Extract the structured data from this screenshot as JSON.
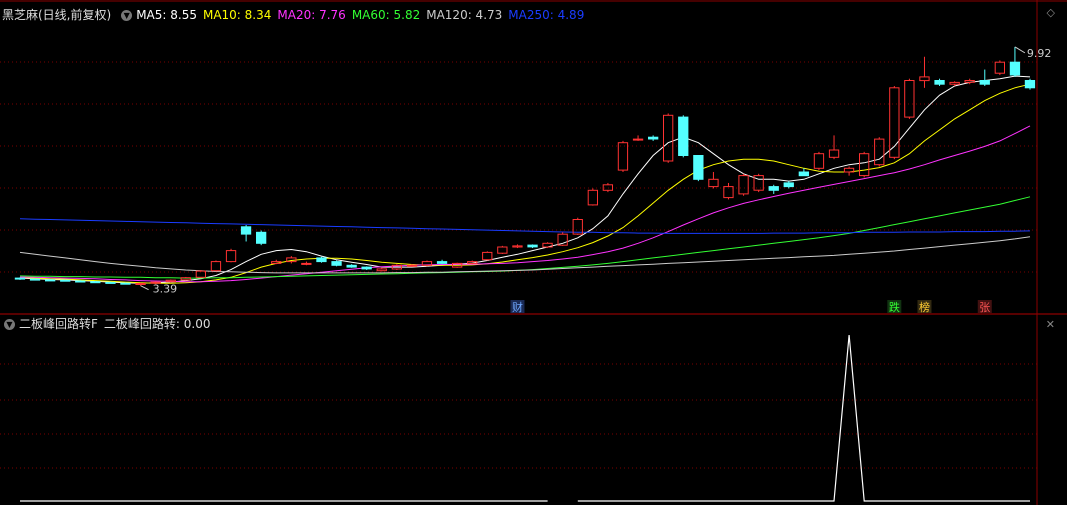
{
  "upper_header": {
    "stock_name": "黑芝麻(日线,前复权)",
    "ma": [
      {
        "label": "MA5: 8.55",
        "color": "#ffffff"
      },
      {
        "label": "MA10: 8.34",
        "color": "#ffff00"
      },
      {
        "label": "MA20: 7.76",
        "color": "#ff33ff"
      },
      {
        "label": "MA60: 5.82",
        "color": "#33ff33"
      },
      {
        "label": "MA120: 4.73",
        "color": "#cccccc"
      },
      {
        "label": "MA250: 4.89",
        "color": "#1a3cff"
      }
    ]
  },
  "lower_header": {
    "indicator_name": "二板峰回路转F",
    "indicator_value": "二板峰回路转: 0.00"
  },
  "chart_data": [
    {
      "type": "candlestick",
      "title": "黑芝麻(日线,前复权)",
      "high_label": "9.92",
      "low_label": "3.39",
      "ylim": [
        3.0,
        10.6
      ],
      "x": [
        1,
        2,
        3,
        4,
        5,
        6,
        7,
        8,
        9,
        10,
        11,
        12,
        13,
        14,
        15,
        16,
        17,
        18,
        19,
        20,
        21,
        22,
        23,
        24,
        25,
        26,
        27,
        28,
        29,
        30,
        31,
        32,
        33,
        34,
        35,
        36,
        37,
        38,
        39,
        40,
        41,
        42,
        43,
        44,
        45,
        46,
        47,
        48,
        49,
        50,
        51,
        52,
        53,
        54,
        55,
        56,
        57,
        58,
        59,
        60,
        61,
        62,
        63,
        64,
        65,
        66,
        67,
        68
      ],
      "open": [
        3.6,
        3.57,
        3.55,
        3.54,
        3.52,
        3.5,
        3.48,
        3.46,
        3.44,
        3.46,
        3.5,
        3.55,
        3.62,
        3.8,
        4.05,
        5.0,
        4.85,
        4.0,
        4.05,
        4.0,
        4.15,
        4.05,
        3.95,
        3.9,
        3.8,
        3.85,
        3.95,
        3.95,
        4.05,
        3.9,
        4.0,
        4.1,
        4.28,
        4.45,
        4.5,
        4.45,
        4.5,
        4.8,
        5.6,
        6.0,
        6.55,
        7.4,
        7.45,
        6.8,
        8.0,
        6.95,
        6.1,
        5.8,
        5.9,
        6.0,
        6.1,
        6.2,
        6.5,
        6.6,
        6.9,
        6.5,
        6.4,
        6.7,
        6.9,
        8.0,
        9.0,
        9.0,
        8.9,
        8.95,
        9.0,
        9.2,
        9.5,
        9.0
      ],
      "close": [
        3.58,
        3.56,
        3.54,
        3.53,
        3.51,
        3.49,
        3.47,
        3.45,
        3.45,
        3.49,
        3.54,
        3.61,
        3.79,
        4.05,
        4.35,
        4.8,
        4.55,
        4.05,
        4.15,
        4.0,
        4.05,
        3.95,
        3.9,
        3.85,
        3.85,
        3.95,
        3.95,
        4.05,
        4.0,
        4.0,
        4.05,
        4.3,
        4.45,
        4.48,
        4.45,
        4.55,
        4.8,
        5.2,
        6.0,
        6.15,
        7.3,
        7.4,
        7.4,
        8.05,
        6.95,
        6.3,
        6.3,
        6.1,
        6.4,
        6.4,
        6.0,
        6.1,
        6.4,
        7.0,
        7.1,
        6.6,
        7.0,
        7.4,
        8.8,
        9.0,
        9.1,
        8.9,
        8.95,
        9.0,
        8.9,
        9.5,
        9.15,
        8.8
      ],
      "high": [
        3.62,
        3.59,
        3.57,
        3.56,
        3.54,
        3.52,
        3.5,
        3.48,
        3.47,
        3.51,
        3.56,
        3.63,
        3.82,
        4.08,
        4.4,
        5.05,
        4.9,
        4.1,
        4.2,
        4.05,
        4.18,
        4.08,
        3.98,
        3.92,
        3.88,
        3.98,
        3.98,
        4.08,
        4.1,
        4.02,
        4.08,
        4.33,
        4.48,
        4.52,
        4.52,
        4.58,
        4.85,
        5.25,
        6.05,
        6.2,
        7.35,
        7.5,
        7.5,
        8.1,
        8.05,
        6.95,
        6.5,
        6.2,
        6.45,
        6.45,
        6.15,
        6.25,
        6.6,
        7.05,
        7.5,
        6.65,
        7.05,
        7.45,
        8.85,
        9.05,
        9.65,
        9.05,
        8.98,
        9.05,
        9.3,
        9.55,
        9.92,
        9.05
      ],
      "low": [
        3.55,
        3.54,
        3.52,
        3.51,
        3.49,
        3.47,
        3.45,
        3.43,
        3.39,
        3.43,
        3.48,
        3.53,
        3.6,
        3.78,
        4.03,
        4.6,
        4.5,
        3.98,
        4.0,
        3.95,
        4.02,
        3.92,
        3.88,
        3.82,
        3.78,
        3.82,
        3.92,
        3.92,
        3.98,
        3.88,
        3.98,
        4.08,
        4.26,
        4.42,
        4.42,
        4.42,
        4.48,
        4.78,
        5.58,
        5.95,
        6.5,
        7.35,
        7.35,
        6.75,
        6.9,
        6.25,
        6.05,
        5.75,
        5.85,
        5.95,
        5.9,
        6.05,
        6.45,
        6.55,
        6.85,
        6.4,
        6.35,
        6.65,
        6.85,
        7.95,
        8.8,
        8.85,
        8.85,
        8.9,
        8.85,
        9.15,
        9.1,
        8.75
      ],
      "ma_lines": [
        {
          "name": "MA5",
          "color": "#ffffff",
          "values": [
            3.6,
            3.58,
            3.56,
            3.55,
            3.53,
            3.51,
            3.49,
            3.47,
            3.46,
            3.47,
            3.49,
            3.53,
            3.58,
            3.67,
            3.83,
            4.05,
            4.25,
            4.35,
            4.38,
            4.32,
            4.2,
            4.1,
            4.03,
            3.97,
            3.9,
            3.9,
            3.9,
            3.92,
            3.95,
            3.98,
            4.01,
            4.08,
            4.17,
            4.25,
            4.35,
            4.45,
            4.55,
            4.7,
            4.95,
            5.3,
            5.9,
            6.45,
            6.95,
            7.3,
            7.45,
            7.3,
            7.0,
            6.7,
            6.45,
            6.3,
            6.3,
            6.25,
            6.3,
            6.45,
            6.6,
            6.7,
            6.75,
            6.85,
            7.2,
            7.7,
            8.2,
            8.6,
            8.85,
            8.95,
            9.0,
            9.05,
            9.12,
            9.1
          ]
        },
        {
          "name": "MA10",
          "color": "#ffff00",
          "values": [
            3.62,
            3.6,
            3.58,
            3.57,
            3.55,
            3.53,
            3.51,
            3.49,
            3.47,
            3.46,
            3.46,
            3.47,
            3.5,
            3.55,
            3.62,
            3.75,
            3.9,
            4.0,
            4.08,
            4.12,
            4.14,
            4.14,
            4.12,
            4.08,
            4.03,
            4.0,
            3.97,
            3.95,
            3.95,
            3.95,
            3.96,
            3.99,
            4.04,
            4.1,
            4.16,
            4.23,
            4.32,
            4.43,
            4.57,
            4.75,
            4.98,
            5.3,
            5.65,
            6.0,
            6.3,
            6.55,
            6.7,
            6.8,
            6.85,
            6.85,
            6.8,
            6.7,
            6.6,
            6.52,
            6.5,
            6.5,
            6.55,
            6.62,
            6.75,
            7.0,
            7.35,
            7.65,
            7.95,
            8.2,
            8.45,
            8.65,
            8.8,
            8.9
          ]
        },
        {
          "name": "MA20",
          "color": "#ff33ff",
          "values": [
            3.63,
            3.62,
            3.61,
            3.6,
            3.59,
            3.58,
            3.56,
            3.55,
            3.53,
            3.52,
            3.51,
            3.5,
            3.5,
            3.51,
            3.53,
            3.56,
            3.6,
            3.64,
            3.68,
            3.72,
            3.76,
            3.8,
            3.84,
            3.88,
            3.91,
            3.93,
            3.95,
            3.96,
            3.97,
            3.98,
            3.98,
            3.99,
            4.0,
            4.02,
            4.05,
            4.08,
            4.12,
            4.17,
            4.24,
            4.32,
            4.42,
            4.55,
            4.7,
            4.87,
            5.05,
            5.22,
            5.38,
            5.52,
            5.64,
            5.74,
            5.83,
            5.92,
            6.0,
            6.08,
            6.16,
            6.24,
            6.32,
            6.4,
            6.48,
            6.58,
            6.7,
            6.83,
            6.95,
            7.07,
            7.2,
            7.35,
            7.55,
            7.76
          ]
        },
        {
          "name": "MA60",
          "color": "#33ff33",
          "values": [
            3.66,
            3.65,
            3.65,
            3.64,
            3.64,
            3.63,
            3.63,
            3.62,
            3.62,
            3.61,
            3.61,
            3.6,
            3.6,
            3.61,
            3.61,
            3.62,
            3.63,
            3.64,
            3.65,
            3.66,
            3.67,
            3.68,
            3.69,
            3.7,
            3.71,
            3.72,
            3.73,
            3.74,
            3.75,
            3.76,
            3.77,
            3.78,
            3.79,
            3.81,
            3.83,
            3.86,
            3.89,
            3.92,
            3.96,
            4.0,
            4.05,
            4.1,
            4.15,
            4.2,
            4.25,
            4.3,
            4.35,
            4.4,
            4.45,
            4.5,
            4.55,
            4.6,
            4.65,
            4.7,
            4.76,
            4.82,
            4.9,
            4.98,
            5.06,
            5.14,
            5.22,
            5.3,
            5.38,
            5.46,
            5.54,
            5.62,
            5.72,
            5.82
          ]
        },
        {
          "name": "MA120",
          "color": "#cccccc",
          "values": [
            4.3,
            4.25,
            4.2,
            4.15,
            4.1,
            4.05,
            4.0,
            3.96,
            3.92,
            3.88,
            3.85,
            3.82,
            3.8,
            3.78,
            3.77,
            3.76,
            3.75,
            3.74,
            3.74,
            3.74,
            3.74,
            3.74,
            3.74,
            3.74,
            3.74,
            3.75,
            3.75,
            3.76,
            3.76,
            3.77,
            3.78,
            3.79,
            3.8,
            3.81,
            3.82,
            3.84,
            3.86,
            3.88,
            3.9,
            3.92,
            3.94,
            3.96,
            3.98,
            4.0,
            4.02,
            4.04,
            4.06,
            4.08,
            4.1,
            4.12,
            4.14,
            4.16,
            4.18,
            4.2,
            4.22,
            4.25,
            4.28,
            4.31,
            4.34,
            4.38,
            4.42,
            4.46,
            4.5,
            4.54,
            4.58,
            4.62,
            4.67,
            4.73
          ]
        },
        {
          "name": "MA250",
          "color": "#1a3cff",
          "values": [
            5.22,
            5.21,
            5.2,
            5.19,
            5.18,
            5.17,
            5.16,
            5.15,
            5.14,
            5.13,
            5.12,
            5.11,
            5.1,
            5.09,
            5.08,
            5.07,
            5.06,
            5.05,
            5.04,
            5.03,
            5.02,
            5.01,
            5.0,
            4.99,
            4.98,
            4.97,
            4.96,
            4.95,
            4.94,
            4.93,
            4.92,
            4.91,
            4.9,
            4.89,
            4.88,
            4.87,
            4.86,
            4.85,
            4.85,
            4.84,
            4.84,
            4.83,
            4.83,
            4.82,
            4.82,
            4.82,
            4.82,
            4.82,
            4.82,
            4.82,
            4.83,
            4.83,
            4.83,
            4.84,
            4.84,
            4.84,
            4.85,
            4.85,
            4.85,
            4.86,
            4.86,
            4.86,
            4.87,
            4.87,
            4.87,
            4.88,
            4.88,
            4.89
          ]
        }
      ],
      "event_tags": [
        {
          "x": 34,
          "label": "财",
          "color": "#6fa8ff",
          "bg": "#1a2a55"
        },
        {
          "x": 59,
          "label": "跌",
          "color": "#33ff33",
          "bg": "#113311"
        },
        {
          "x": 61,
          "label": "榜",
          "color": "#ffcc33",
          "bg": "#332a11"
        },
        {
          "x": 65,
          "label": "张",
          "color": "#ff5555",
          "bg": "#441111"
        }
      ]
    },
    {
      "type": "line",
      "title": "二板峰回路转",
      "ylim": [
        0,
        1
      ],
      "x": [
        1,
        2,
        3,
        4,
        5,
        6,
        7,
        8,
        9,
        10,
        11,
        12,
        13,
        14,
        15,
        16,
        17,
        18,
        19,
        20,
        21,
        22,
        23,
        24,
        25,
        26,
        27,
        28,
        29,
        30,
        31,
        32,
        33,
        34,
        35,
        36,
        37,
        38,
        39,
        40,
        41,
        42,
        43,
        44,
        45,
        46,
        47,
        48,
        49,
        50,
        51,
        52,
        53,
        54,
        55,
        56,
        57,
        58,
        59,
        60,
        61,
        62,
        63,
        64,
        65,
        66,
        67,
        68
      ],
      "values": [
        0,
        0,
        0,
        0,
        0,
        0,
        0,
        0,
        0,
        0,
        0,
        0,
        0,
        0,
        0,
        0,
        0,
        0,
        0,
        0,
        0,
        0,
        0,
        0,
        0,
        0,
        0,
        0,
        0,
        0,
        0,
        0,
        0,
        0,
        0,
        0,
        null,
        0,
        0,
        0,
        0,
        0,
        0,
        0,
        0,
        0,
        0,
        0,
        0,
        0,
        0,
        0,
        0,
        0,
        0,
        1,
        0,
        0,
        0,
        0,
        0,
        0,
        0,
        0,
        0,
        0,
        0,
        0
      ]
    }
  ]
}
